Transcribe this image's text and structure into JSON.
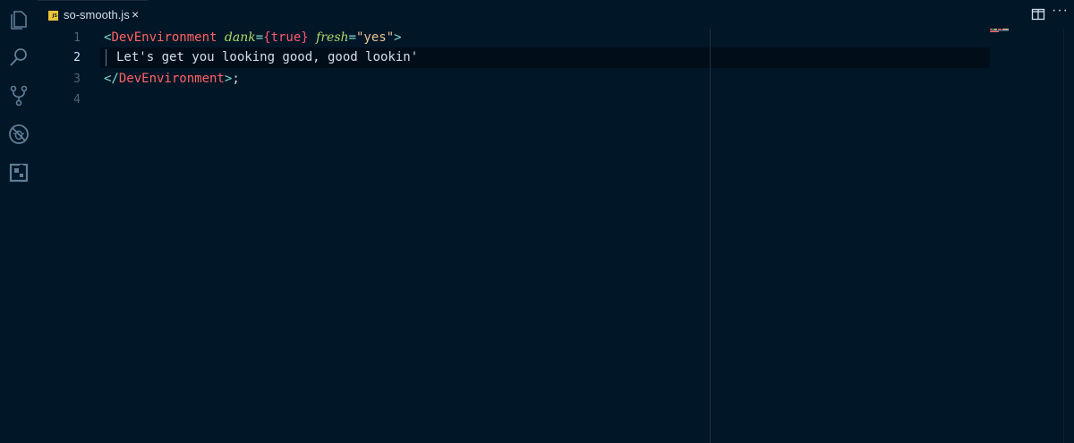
{
  "activity_bar": {
    "items": [
      {
        "icon": "files-icon"
      },
      {
        "icon": "search-icon"
      },
      {
        "icon": "source-control-icon"
      },
      {
        "icon": "debug-icon"
      },
      {
        "icon": "extensions-icon"
      }
    ]
  },
  "tabs": [
    {
      "badge": "JS",
      "title": "so-smooth.js",
      "close": "×"
    }
  ],
  "editor_actions": {
    "more": "···"
  },
  "editor": {
    "active_line": 2,
    "line_numbers": [
      "1",
      "2",
      "3",
      "4"
    ],
    "lines": {
      "l1": {
        "open": "<",
        "tag": "DevEnvironment",
        "attr1": "dank",
        "eq1": "=",
        "brace_open": "{",
        "value1": "true",
        "brace_close": "}",
        "attr2": "fresh",
        "eq2": "=",
        "value2": "\"yes\"",
        "close": ">"
      },
      "l2": {
        "text": "Let's get you looking good, good lookin'"
      },
      "l3": {
        "open": "</",
        "tag": "DevEnvironment",
        "close": ">",
        "semicolon": ";"
      }
    }
  },
  "colors": {
    "background": "#011627",
    "tag": "#ff6363",
    "attribute": "#addb67",
    "string": "#ecc48d",
    "bracket": "#7fdbca",
    "text": "#d6deeb"
  }
}
